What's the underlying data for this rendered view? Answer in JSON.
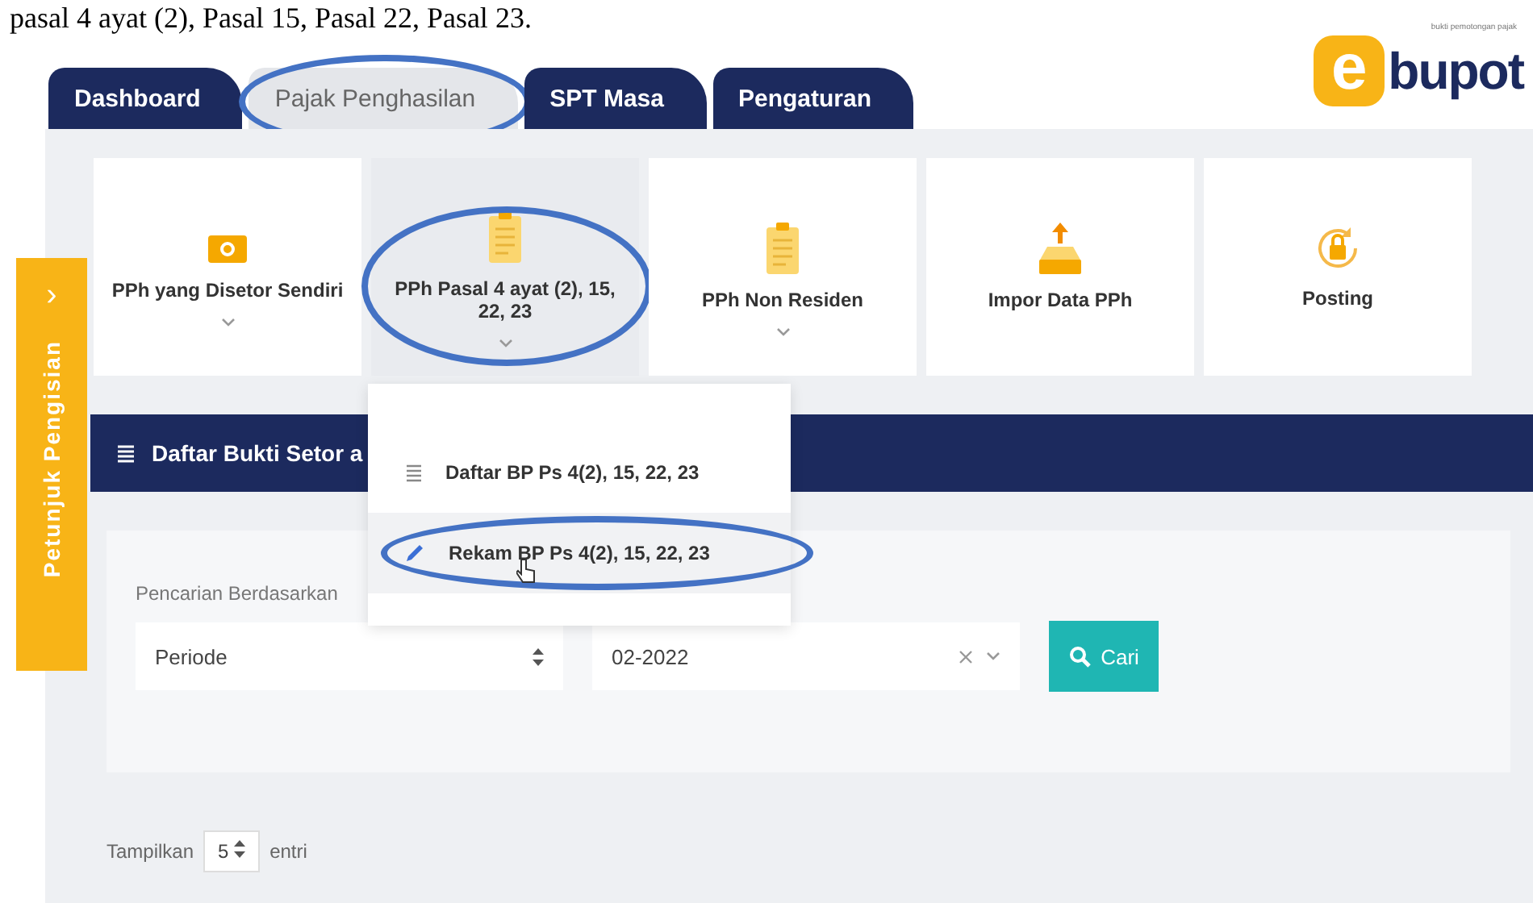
{
  "document_text": "pasal 4 ayat (2), Pasal 15, Pasal 22, Pasal 23.",
  "logo": {
    "letter": "e",
    "word": "bupot",
    "tagline": "bukti pemotongan pajak"
  },
  "tabs": [
    {
      "label": "Dashboard",
      "selected": false,
      "circled": false
    },
    {
      "label": "Pajak Penghasilan",
      "selected": true,
      "circled": true
    },
    {
      "label": "SPT Masa",
      "selected": false,
      "circled": false
    },
    {
      "label": "Pengaturan",
      "selected": false,
      "circled": false
    }
  ],
  "menu_cards": [
    {
      "label": "PPh yang Disetor Sendiri",
      "kind": "wallet",
      "has_caret": true,
      "selected": false,
      "circled": false
    },
    {
      "label": "PPh Pasal 4 ayat (2), 15, 22, 23",
      "kind": "clipboard",
      "has_caret": true,
      "selected": true,
      "circled": true
    },
    {
      "label": "PPh Non Residen",
      "kind": "clipboard",
      "has_caret": true,
      "selected": false,
      "circled": false
    },
    {
      "label": "Impor Data PPh",
      "kind": "upload",
      "has_caret": false,
      "selected": false,
      "circled": false
    },
    {
      "label": "Posting",
      "kind": "lock",
      "has_caret": false,
      "selected": false,
      "circled": false
    }
  ],
  "dropdown": [
    {
      "label": "Daftar BP Ps 4(2), 15, 22, 23",
      "kind": "list",
      "selected": false,
      "circled": false
    },
    {
      "label": "Rekam BP Ps 4(2), 15, 22, 23",
      "kind": "edit",
      "selected": true,
      "circled": true
    }
  ],
  "side_tab": {
    "label": "Petunjuk Pengisian",
    "icon": "›"
  },
  "section_title": "Daftar Bukti Setor a",
  "search": {
    "label": "Pencarian Berdasarkan",
    "criteria": "Periode",
    "value": "02-2022",
    "button": "Cari"
  },
  "page_size": {
    "label": "Tampilkan",
    "value": "5",
    "suffix": "entri"
  }
}
